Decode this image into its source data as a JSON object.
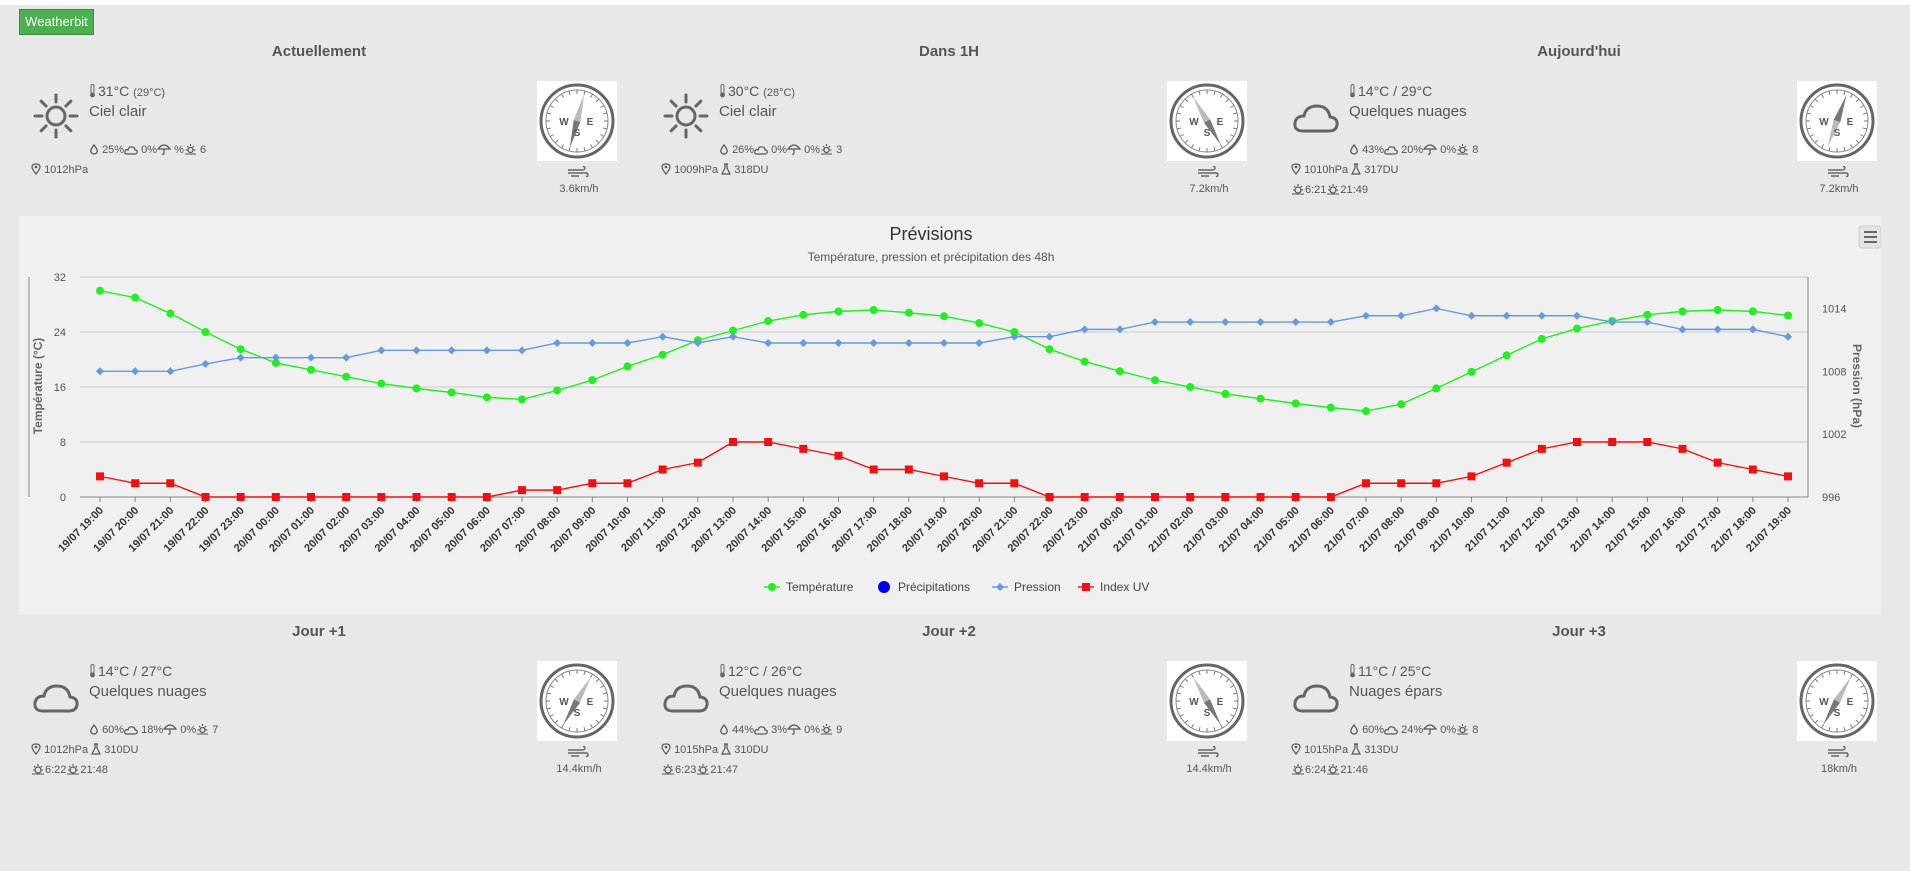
{
  "source_label": "Weatherbit",
  "cards": [
    {
      "title": "Actuellement",
      "temp": "31°C",
      "feels": "(29°C)",
      "description": "Ciel clair",
      "icon": "sun-icon",
      "humidity": "25%",
      "clouds": "0%",
      "precip": "%",
      "uv": "6",
      "pressure": "1012hPa",
      "air_quality": "",
      "sunrise": "",
      "sunset": "",
      "wind_speed": "3.6km/h",
      "wind_dir_deg": 15
    },
    {
      "title": "Dans 1H",
      "temp": "30°C",
      "feels": "(28°C)",
      "description": "Ciel clair",
      "icon": "sun-icon",
      "humidity": "26%",
      "clouds": "0%",
      "precip": "0%",
      "uv": "3",
      "pressure": "1009hPa",
      "air_quality": "318DU",
      "sunrise": "",
      "sunset": "",
      "wind_speed": "7.2km/h",
      "wind_dir_deg": 330
    },
    {
      "title": "Aujourd'hui",
      "temp": "14°C /  29°C",
      "feels": "",
      "description": "Quelques nuages",
      "icon": "cloud-icon",
      "humidity": "43%",
      "clouds": "20%",
      "precip": "0%",
      "uv": "8",
      "pressure": "1010hPa",
      "air_quality": "317DU",
      "sunrise": "6:21",
      "sunset": "21:49",
      "wind_speed": "7.2km/h",
      "wind_dir_deg": 200
    },
    {
      "title": "Jour +1",
      "temp": "14°C /  27°C",
      "feels": "",
      "description": "Quelques nuages",
      "icon": "cloud-icon",
      "humidity": "60%",
      "clouds": "18%",
      "precip": "0%",
      "uv": "7",
      "pressure": "1012hPa",
      "air_quality": "310DU",
      "sunrise": "6:22",
      "sunset": "21:48",
      "wind_speed": "14.4km/h",
      "wind_dir_deg": 30
    },
    {
      "title": "Jour +2",
      "temp": "12°C /  26°C",
      "feels": "",
      "description": "Quelques nuages",
      "icon": "cloud-icon",
      "humidity": "44%",
      "clouds": "3%",
      "precip": "0%",
      "uv": "9",
      "pressure": "1015hPa",
      "air_quality": "310DU",
      "sunrise": "6:23",
      "sunset": "21:47",
      "wind_speed": "14.4km/h",
      "wind_dir_deg": 330
    },
    {
      "title": "Jour +3",
      "temp": "11°C /  25°C",
      "feels": "",
      "description": "Nuages épars",
      "icon": "cloud-icon",
      "humidity": "60%",
      "clouds": "24%",
      "precip": "0%",
      "uv": "8",
      "pressure": "1015hPa",
      "air_quality": "313DU",
      "sunrise": "6:24",
      "sunset": "21:46",
      "wind_speed": "18km/h",
      "wind_dir_deg": 30
    }
  ],
  "compass_labels": {
    "w": "W",
    "e": "E",
    "s": "S"
  },
  "chart_data": {
    "type": "line",
    "title": "Prévisions",
    "subtitle": "Température, pression et précipitation des 48h",
    "ylabel_left": "Température (°C)",
    "ylabel_right": "Pression (hPa)",
    "ylim_left": [
      0,
      32
    ],
    "ylim_right": [
      996,
      1017
    ],
    "yticks_left": [
      "0",
      "8",
      "16",
      "24",
      "32"
    ],
    "yticks_right": [
      "996",
      "1002",
      "1008",
      "1014"
    ],
    "grid": true,
    "legend_position": "bottom",
    "categories": [
      "19/07 19:00",
      "19/07 20:00",
      "19/07 21:00",
      "19/07 22:00",
      "19/07 23:00",
      "20/07 00:00",
      "20/07 01:00",
      "20/07 02:00",
      "20/07 03:00",
      "20/07 04:00",
      "20/07 05:00",
      "20/07 06:00",
      "20/07 07:00",
      "20/07 08:00",
      "20/07 09:00",
      "20/07 10:00",
      "20/07 11:00",
      "20/07 12:00",
      "20/07 13:00",
      "20/07 14:00",
      "20/07 15:00",
      "20/07 16:00",
      "20/07 17:00",
      "20/07 18:00",
      "20/07 19:00",
      "20/07 20:00",
      "20/07 21:00",
      "20/07 22:00",
      "20/07 23:00",
      "21/07 00:00",
      "21/07 01:00",
      "21/07 02:00",
      "21/07 03:00",
      "21/07 04:00",
      "21/07 05:00",
      "21/07 06:00",
      "21/07 07:00",
      "21/07 08:00",
      "21/07 09:00",
      "21/07 10:00",
      "21/07 11:00",
      "21/07 12:00",
      "21/07 13:00",
      "21/07 14:00",
      "21/07 15:00",
      "21/07 16:00",
      "21/07 17:00",
      "21/07 18:00",
      "21/07 19:00"
    ],
    "series": [
      {
        "name": "Température",
        "axis": "left",
        "color": "#22ee22",
        "marker": "circle",
        "values": [
          30,
          29,
          26.7,
          24,
          21.5,
          19.5,
          18.5,
          17.5,
          16.5,
          15.8,
          15.2,
          14.5,
          14.2,
          15.5,
          17,
          19,
          20.7,
          22.8,
          24.2,
          25.6,
          26.5,
          27,
          27.2,
          26.8,
          26.3,
          25.3,
          24,
          21.5,
          19.7,
          18.3,
          17,
          16,
          15,
          14.3,
          13.6,
          13,
          12.5,
          13.5,
          15.8,
          18.2,
          20.6,
          23,
          24.5,
          25.6,
          26.5,
          27,
          27.2,
          27,
          26.4
        ]
      },
      {
        "name": "Précipitations",
        "axis": "left",
        "color": "#0000ee",
        "marker": "circle",
        "values": []
      },
      {
        "name": "Pression",
        "axis": "right",
        "color": "#6699dd",
        "marker": "diamond",
        "values": [
          1008,
          1008,
          1008,
          1008.7,
          1009.3,
          1009.3,
          1009.3,
          1009.3,
          1010,
          1010,
          1010,
          1010,
          1010,
          1010.7,
          1010.7,
          1010.7,
          1011.3,
          1010.7,
          1011.3,
          1010.7,
          1010.7,
          1010.7,
          1010.7,
          1010.7,
          1010.7,
          1010.7,
          1011.3,
          1011.3,
          1012,
          1012,
          1012.7,
          1012.7,
          1012.7,
          1012.7,
          1012.7,
          1012.7,
          1013.3,
          1013.3,
          1014,
          1013.3,
          1013.3,
          1013.3,
          1013.3,
          1012.7,
          1012.7,
          1012,
          1012,
          1012,
          1011.3
        ]
      },
      {
        "name": "Index UV",
        "axis": "left",
        "color": "#ee1111",
        "marker": "square",
        "values": [
          3,
          2,
          2,
          0,
          0,
          0,
          0,
          0,
          0,
          0,
          0,
          0,
          1,
          1,
          2,
          2,
          4,
          5,
          8,
          8,
          7,
          6,
          4,
          4,
          3,
          2,
          2,
          0,
          0,
          0,
          0,
          0,
          0,
          0,
          0,
          0,
          2,
          2,
          2,
          3,
          5,
          7,
          8,
          8,
          8,
          7,
          5,
          4,
          3
        ]
      }
    ]
  }
}
